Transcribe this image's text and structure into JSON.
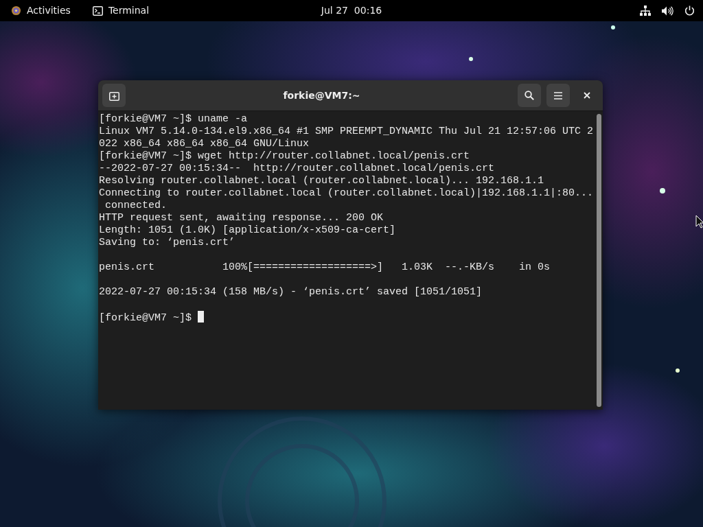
{
  "top_bar": {
    "activities": "Activities",
    "app_menu": "Terminal",
    "clock": "Jul 27  00:16"
  },
  "window": {
    "title": "forkie@VM7:~",
    "focused": true
  },
  "terminal": {
    "cursor": true,
    "blocks": [
      {
        "lines": [
          "[forkie@VM7 ~]$ uname -a",
          "Linux VM7 5.14.0-134.el9.x86_64 #1 SMP PREEMPT_DYNAMIC Thu Jul 21 12:57:06 UTC 2",
          "022 x86_64 x86_64 x86_64 GNU/Linux",
          "[forkie@VM7 ~]$ wget http://router.collabnet.local/penis.crt",
          "--2022-07-27 00:15:34--  http://router.collabnet.local/penis.crt",
          "Resolving router.collabnet.local (router.collabnet.local)... 192.168.1.1",
          "Connecting to router.collabnet.local (router.collabnet.local)|192.168.1.1|:80...",
          " connected.",
          "HTTP request sent, awaiting response... 200 OK",
          "Length: 1051 (1.0K) [application/x-x509-ca-cert]",
          "Saving to: ‘penis.crt’"
        ]
      },
      {
        "lines": [
          "penis.crt           100%[===================>]   1.03K  --.-KB/s    in 0s"
        ]
      },
      {
        "lines": [
          "2022-07-27 00:15:34 (158 MB/s) - ‘penis.crt’ saved [1051/1051]"
        ]
      },
      {
        "lines": [
          "[forkie@VM7 ~]$ "
        ]
      }
    ]
  }
}
